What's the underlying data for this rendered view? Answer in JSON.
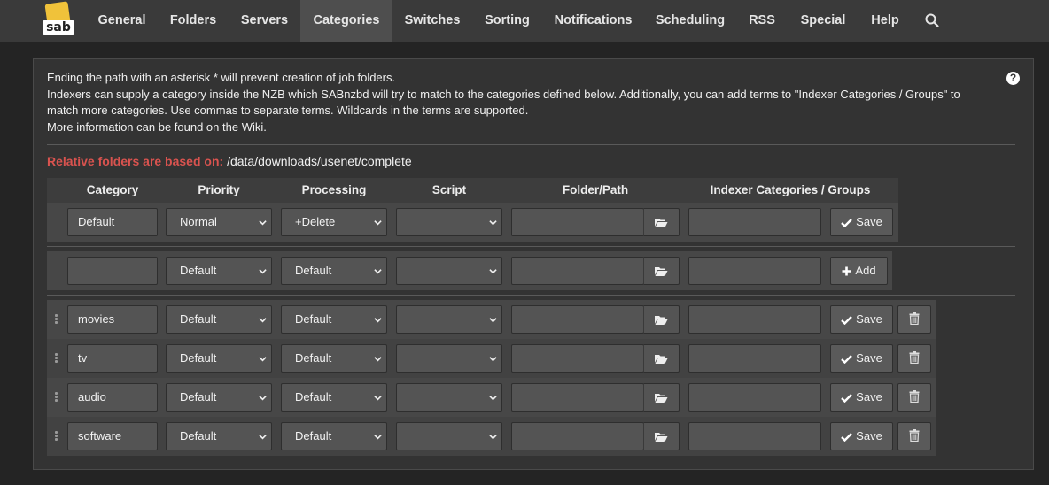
{
  "nav": {
    "logo_text": "sab",
    "items": [
      "General",
      "Folders",
      "Servers",
      "Categories",
      "Switches",
      "Sorting",
      "Notifications",
      "Scheduling",
      "RSS",
      "Special",
      "Help"
    ],
    "active": "Categories"
  },
  "info": {
    "line1": "Ending the path with an asterisk * will prevent creation of job folders.",
    "line2": "Indexers can supply a category inside the NZB which SABnzbd will try to match to the categories defined below. Additionally, you can add terms to \"Indexer Categories / Groups\" to match more categories. Use commas to separate terms. Wildcards in the terms are supported.",
    "line3": "More information can be found on the Wiki."
  },
  "relative": {
    "label": "Relative folders are based on:",
    "path": "/data/downloads/usenet/complete"
  },
  "table": {
    "headers": [
      "Category",
      "Priority",
      "Processing",
      "Script",
      "Folder/Path",
      "Indexer Categories / Groups"
    ],
    "default_row": {
      "category": "Default",
      "priority": "Normal",
      "processing": "+Delete",
      "script": "",
      "folder": "",
      "groups": "",
      "button": "Save"
    },
    "new_row": {
      "category": "",
      "priority": "Default",
      "processing": "Default",
      "script": "",
      "folder": "",
      "groups": "",
      "button": "Add"
    },
    "rows": [
      {
        "category": "movies",
        "priority": "Default",
        "processing": "Default",
        "script": "",
        "folder": "",
        "groups": "",
        "button": "Save"
      },
      {
        "category": "tv",
        "priority": "Default",
        "processing": "Default",
        "script": "",
        "folder": "",
        "groups": "",
        "button": "Save"
      },
      {
        "category": "audio",
        "priority": "Default",
        "processing": "Default",
        "script": "",
        "folder": "",
        "groups": "",
        "button": "Save"
      },
      {
        "category": "software",
        "priority": "Default",
        "processing": "Default",
        "script": "",
        "folder": "",
        "groups": "",
        "button": "Save"
      }
    ]
  },
  "colors": {
    "background": "#242424",
    "navbar": "#3a3a3a",
    "panel": "#333333",
    "accent_red": "#d9534f",
    "logo_yellow": "#f0c23a"
  }
}
